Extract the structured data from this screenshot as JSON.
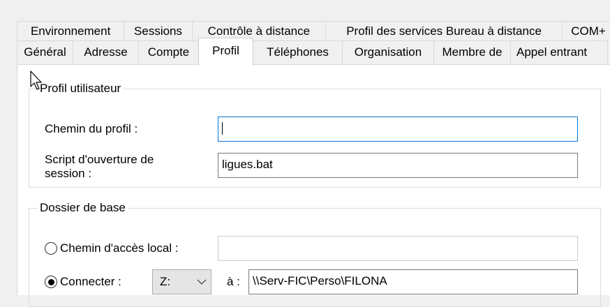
{
  "tabs_row1": [
    {
      "label": "Environnement"
    },
    {
      "label": "Sessions"
    },
    {
      "label": "Contrôle à distance"
    },
    {
      "label": "Profil des services Bureau à distance"
    },
    {
      "label": "COM+"
    }
  ],
  "tabs_row2": [
    {
      "label": "Général"
    },
    {
      "label": "Adresse"
    },
    {
      "label": "Compte"
    },
    {
      "label": "Profil",
      "active": true
    },
    {
      "label": "Téléphones"
    },
    {
      "label": "Organisation"
    },
    {
      "label": "Membre de"
    },
    {
      "label": "Appel entrant"
    }
  ],
  "profile_group": {
    "legend": "Profil utilisateur",
    "profile_path_label": "Chemin du profil :",
    "profile_path_value": "",
    "logon_script_label_line1": "Script d'ouverture de",
    "logon_script_label_line2": "session :",
    "logon_script_value": "ligues.bat"
  },
  "home_group": {
    "legend": "Dossier de base",
    "local_path_label": "Chemin d'accès local :",
    "local_path_value": "",
    "local_path_selected": false,
    "connect_label": "Connecter :",
    "connect_selected": true,
    "drive_value": "Z:",
    "to_label": "à :",
    "connect_path_value": "\\\\Serv-FIC\\Perso\\FILONA"
  },
  "colors": {
    "window_bg": "#f0f0f0",
    "panel_bg": "#ffffff",
    "focus_border": "#0078d7",
    "tab_border": "#d9d9d9"
  },
  "icons": {
    "mouse": "arrow-cursor-icon",
    "dropdown": "chevron-down-icon"
  }
}
